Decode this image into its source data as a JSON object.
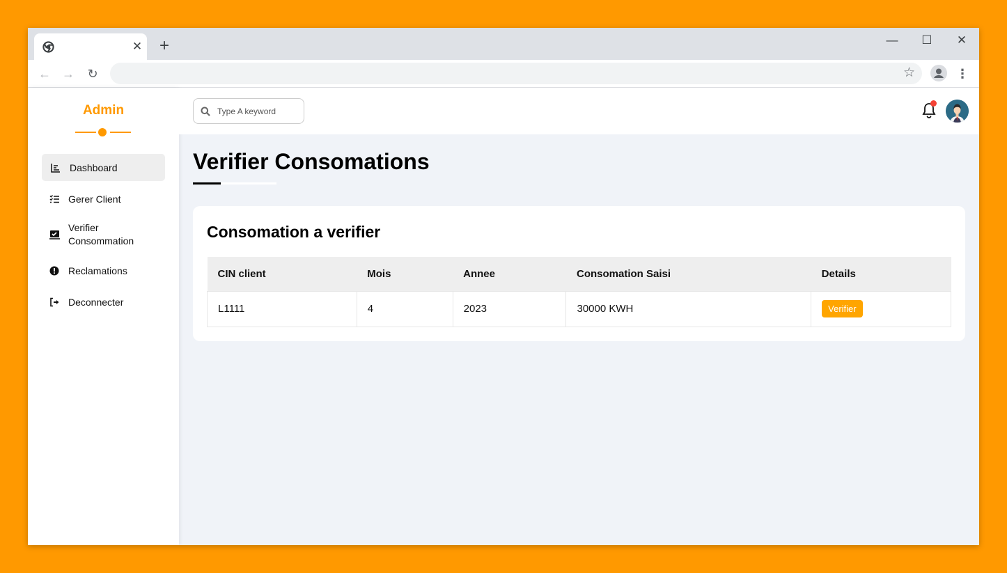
{
  "browser": {
    "tab_close_glyph": "✕",
    "new_tab_glyph": "+",
    "window_controls": {
      "minimize": "—",
      "maximize": "☐",
      "close": "✕"
    },
    "nav": {
      "back": "←",
      "forward": "→",
      "reload": "↻"
    },
    "address_value": "",
    "star_glyph": "☆",
    "menu_glyph": "⋮"
  },
  "sidebar": {
    "brand": "Admin",
    "accent_color": "#ff9900",
    "items": [
      {
        "label": "Dashboard",
        "icon": "chart-bar-icon",
        "active": true
      },
      {
        "label": "Gerer Client",
        "icon": "list-check-icon",
        "active": false
      },
      {
        "label": "Verifier Consommation",
        "icon": "checkbox-icon",
        "active": false
      },
      {
        "label": "Reclamations",
        "icon": "exclamation-circle-icon",
        "active": false
      },
      {
        "label": "Deconnecter",
        "icon": "sign-out-icon",
        "active": false
      }
    ]
  },
  "header": {
    "search_placeholder": "Type A keyword",
    "notification_badge_color": "#f44336"
  },
  "main": {
    "title": "Verifier Consomations",
    "card_title": "Consomation a verifier",
    "table": {
      "columns": [
        "CIN client",
        "Mois",
        "Annee",
        "Consomation Saisi",
        "Details"
      ],
      "rows": [
        {
          "cin": "L1111",
          "mois": "4",
          "annee": "2023",
          "consomation": "30000 KWH",
          "action": "Verifier"
        }
      ]
    }
  }
}
